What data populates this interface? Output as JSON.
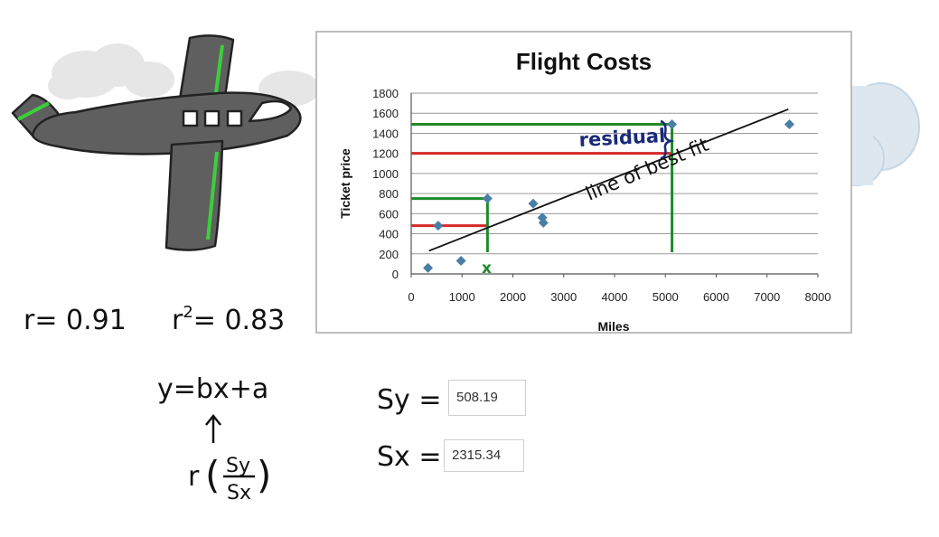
{
  "chart_data": {
    "type": "scatter",
    "title": "Flight Costs",
    "xlabel": "Miles",
    "ylabel": "Ticket price",
    "xlim": [
      0,
      8000
    ],
    "ylim": [
      0,
      1800
    ],
    "xticks": [
      0,
      1000,
      2000,
      3000,
      4000,
      5000,
      6000,
      7000,
      8000
    ],
    "yticks": [
      0,
      200,
      400,
      600,
      800,
      1000,
      1200,
      1400,
      1600,
      1800
    ],
    "grid": "horizontal",
    "point_color": "#4a7fa5",
    "points": [
      {
        "x": 330,
        "y": 60
      },
      {
        "x": 530,
        "y": 480
      },
      {
        "x": 980,
        "y": 130
      },
      {
        "x": 1500,
        "y": 750
      },
      {
        "x": 2400,
        "y": 700
      },
      {
        "x": 2580,
        "y": 560
      },
      {
        "x": 2600,
        "y": 510
      },
      {
        "x": 5130,
        "y": 1490
      },
      {
        "x": 7440,
        "y": 1490
      }
    ],
    "fit_line": {
      "x": [
        350,
        7420
      ],
      "y": [
        230,
        1640
      ],
      "label": "line of best fit"
    },
    "annotations": {
      "residual_label": "residual",
      "marker_label": "x",
      "green_color": "#1e8a2a",
      "red_color": "#d62828",
      "green_lines": [
        {
          "at_x": 1500,
          "y": 750
        },
        {
          "at_x": 5130,
          "y": 1490
        }
      ],
      "red_lines": [
        {
          "at_x": 1500,
          "y": 480
        },
        {
          "at_x": 5130,
          "y": 1200
        }
      ]
    }
  },
  "stats": {
    "r": "r= 0.91",
    "r2_base": "r",
    "r2_exp": "2",
    "r2_rest": "= 0.83",
    "equation": "y=bx+a",
    "slope_r": "r",
    "slope_num": "Sy",
    "slope_den": "Sx",
    "sy_label": "Sy =",
    "sx_label": "Sx =",
    "sy_value": "508.19",
    "sx_value": "2315.34"
  },
  "colors": {
    "plane_body": "#5f5f5f",
    "plane_stripe": "#3ccf3c",
    "cloud": "#e6e6e6",
    "cloud_right": "#dde7ef"
  }
}
